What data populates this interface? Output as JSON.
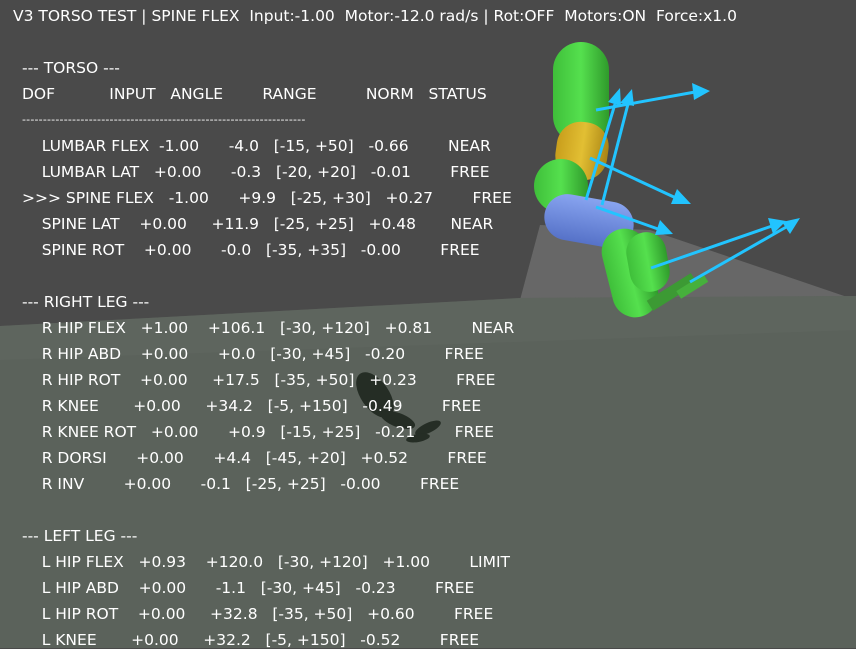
{
  "status_bar": "V3 TORSO TEST | SPINE FLEX  Input:-1.00  Motor:-12.0 rad/s | Rot:OFF  Motors:ON  Force:x1.0",
  "torso": {
    "header": "--- TORSO ---",
    "columns": "DOF           INPUT   ANGLE        RANGE          NORM   STATUS",
    "separator": "--------------------------------------------------------------------",
    "rows": [
      "    LUMBAR FLEX  -1.00      -4.0   [-15, +50]   -0.66        NEAR",
      "    LUMBAR LAT   +0.00      -0.3   [-20, +20]   -0.01        FREE",
      ">>> SPINE FLEX   -1.00      +9.9   [-25, +30]   +0.27        FREE",
      "    SPINE LAT    +0.00     +11.9   [-25, +25]   +0.48       NEAR",
      "    SPINE ROT    +0.00      -0.0   [-35, +35]   -0.00        FREE"
    ]
  },
  "right_leg": {
    "header": "--- RIGHT LEG ---",
    "rows": [
      "    R HIP FLEX   +1.00    +106.1   [-30, +120]   +0.81        NEAR",
      "    R HIP ABD    +0.00      +0.0   [-30, +45]   -0.20        FREE",
      "    R HIP ROT    +0.00     +17.5   [-35, +50]   +0.23        FREE",
      "    R KNEE       +0.00     +34.2   [-5, +150]   -0.49        FREE",
      "    R KNEE ROT   +0.00      +0.9   [-15, +25]   -0.21        FREE",
      "    R DORSI      +0.00      +4.4   [-45, +20]   +0.52        FREE",
      "    R INV        +0.00      -0.1   [-25, +25]   -0.00        FREE"
    ]
  },
  "left_leg": {
    "header": "--- LEFT LEG ---",
    "rows": [
      "    L HIP FLEX   +0.93    +120.0   [-30, +120]   +1.00        LIMIT",
      "    L HIP ABD    +0.00      -1.1   [-30, +45]   -0.23        FREE",
      "    L HIP ROT    +0.00     +32.8   [-35, +50]   +0.60        FREE",
      "    L KNEE       +0.00     +32.2   [-5, +150]   -0.52        FREE"
    ]
  },
  "colors": {
    "sky": "#4a4a4a",
    "ground": "#5c635c",
    "ramp": "#686868",
    "limb_green": "#4fd64a",
    "torso_yellow": "#d8b428",
    "pelvis_blue": "#6f8fe6",
    "force_arrow": "#22c4ff"
  }
}
